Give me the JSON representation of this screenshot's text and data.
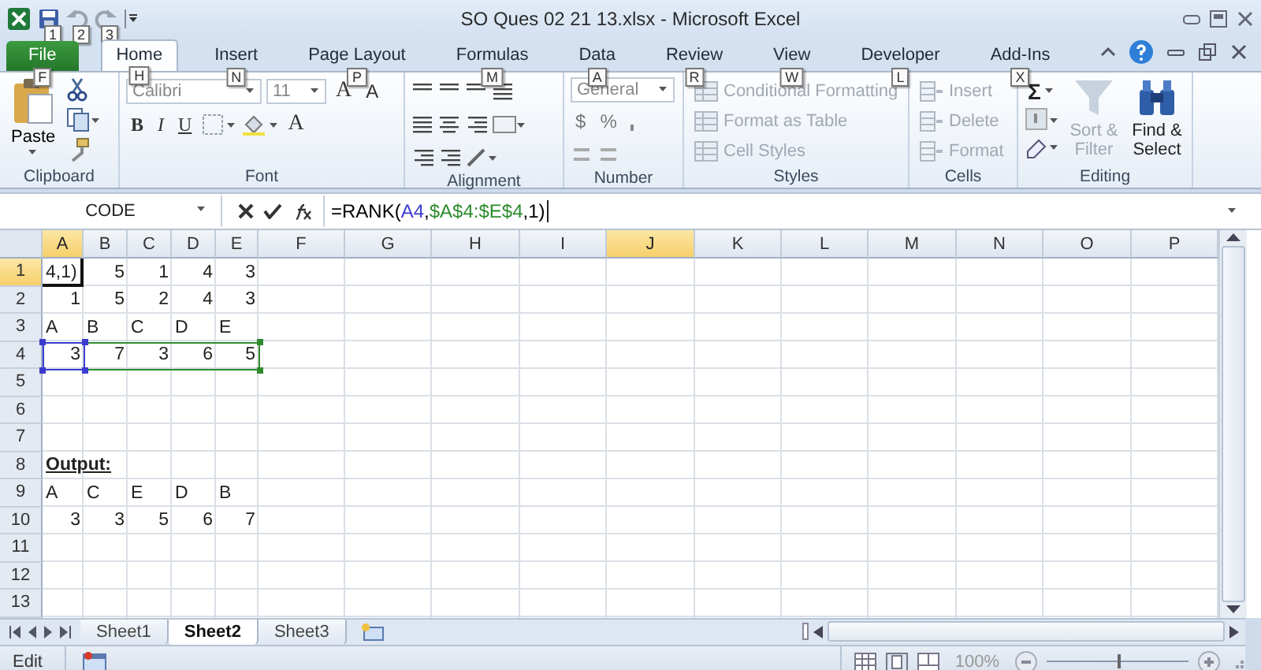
{
  "title_bar": {
    "quick_access": [
      {
        "kind": "save",
        "keytip": "1"
      },
      {
        "kind": "undo",
        "keytip": "2"
      },
      {
        "kind": "redo",
        "keytip": "3"
      }
    ],
    "title": "SO Ques 02 21 13.xlsx - Microsoft Excel"
  },
  "tabs": [
    {
      "label": "File",
      "keytip": "F",
      "kind": "file",
      "selected": false
    },
    {
      "label": "Home",
      "keytip": "H",
      "kind": "tab",
      "selected": true
    },
    {
      "label": "Insert",
      "keytip": "N",
      "kind": "tab",
      "selected": false
    },
    {
      "label": "Page Layout",
      "keytip": "P",
      "kind": "tab",
      "selected": false
    },
    {
      "label": "Formulas",
      "keytip": "M",
      "kind": "tab",
      "selected": false
    },
    {
      "label": "Data",
      "keytip": "A",
      "kind": "tab",
      "selected": false
    },
    {
      "label": "Review",
      "keytip": "R",
      "kind": "tab",
      "selected": false
    },
    {
      "label": "View",
      "keytip": "W",
      "kind": "tab",
      "selected": false
    },
    {
      "label": "Developer",
      "keytip": "L",
      "kind": "tab",
      "selected": false
    },
    {
      "label": "Add-Ins",
      "keytip": "X",
      "kind": "tab",
      "selected": false
    }
  ],
  "ribbon": {
    "clipboard": {
      "label": "Clipboard",
      "paste": "Paste"
    },
    "font": {
      "label": "Font",
      "name": "Calibri",
      "size": "11",
      "grow": "A",
      "shrink": "A",
      "bold": "B",
      "italic": "I",
      "underline": "U",
      "font_color": "A"
    },
    "alignment": {
      "label": "Alignment"
    },
    "number": {
      "label": "Number",
      "format": "General",
      "symbols": [
        "$",
        "%"
      ]
    },
    "styles": {
      "label": "Styles",
      "items": [
        {
          "label": "Conditional Formatting",
          "disabled": true
        },
        {
          "label": "Format as Table",
          "disabled": true
        },
        {
          "label": "Cell Styles",
          "disabled": true
        }
      ]
    },
    "cells": {
      "label": "Cells",
      "items": [
        {
          "label": "Insert",
          "disabled": true
        },
        {
          "label": "Delete",
          "disabled": true
        },
        {
          "label": "Format",
          "disabled": true
        }
      ]
    },
    "editing": {
      "label": "Editing",
      "sum": "Σ",
      "sort": {
        "label": "Sort & Filter",
        "disabled": true
      },
      "find": {
        "label": "Find & Select",
        "disabled": false
      }
    }
  },
  "formula_bar": {
    "name_box": "CODE",
    "parts": [
      {
        "text": "=RANK(",
        "color": "#000000"
      },
      {
        "text": "A4",
        "color": "#3c3cd0"
      },
      {
        "text": ",",
        "color": "#000000"
      },
      {
        "text": "$A$4:$E$4",
        "color": "#2e8b2e"
      },
      {
        "text": ",1)",
        "color": "#000000"
      }
    ]
  },
  "columns": [
    {
      "label": "A",
      "selected": true
    },
    {
      "label": "B",
      "selected": false
    },
    {
      "label": "C",
      "selected": false
    },
    {
      "label": "D",
      "selected": false
    },
    {
      "label": "E",
      "selected": false
    },
    {
      "label": "F",
      "selected": false
    },
    {
      "label": "G",
      "selected": false
    },
    {
      "label": "H",
      "selected": false
    },
    {
      "label": "I",
      "selected": false
    },
    {
      "label": "J",
      "selected": true
    },
    {
      "label": "K",
      "selected": false
    },
    {
      "label": "L",
      "selected": false
    },
    {
      "label": "M",
      "selected": false
    },
    {
      "label": "N",
      "selected": false
    },
    {
      "label": "O",
      "selected": false
    },
    {
      "label": "P",
      "selected": false
    }
  ],
  "rows": [
    {
      "number": "1",
      "selected": true,
      "editing": true,
      "kind": "number",
      "cells": [
        "4,1)",
        "5",
        "1",
        "4",
        "3"
      ]
    },
    {
      "number": "2",
      "selected": false,
      "editing": false,
      "kind": "number",
      "cells": [
        "1",
        "5",
        "2",
        "4",
        "3"
      ]
    },
    {
      "number": "3",
      "selected": false,
      "editing": false,
      "kind": "text",
      "cells": [
        "A",
        "B",
        "C",
        "D",
        "E"
      ]
    },
    {
      "number": "4",
      "selected": false,
      "editing": false,
      "kind": "number",
      "cells": [
        "3",
        "7",
        "3",
        "6",
        "5"
      ]
    },
    {
      "number": "5",
      "selected": false,
      "editing": false,
      "kind": "text",
      "cells": []
    },
    {
      "number": "6",
      "selected": false,
      "editing": false,
      "kind": "text",
      "cells": []
    },
    {
      "number": "7",
      "selected": false,
      "editing": false,
      "kind": "text",
      "cells": []
    },
    {
      "number": "8",
      "selected": false,
      "editing": false,
      "kind": "heading",
      "cells": [
        "Output:"
      ]
    },
    {
      "number": "9",
      "selected": false,
      "editing": false,
      "kind": "text",
      "cells": [
        "A",
        "C",
        "E",
        "D",
        "B"
      ]
    },
    {
      "number": "10",
      "selected": false,
      "editing": false,
      "kind": "number",
      "cells": [
        "3",
        "3",
        "5",
        "6",
        "7"
      ]
    },
    {
      "number": "11",
      "selected": false,
      "editing": false,
      "kind": "text",
      "cells": []
    },
    {
      "number": "12",
      "selected": false,
      "editing": false,
      "kind": "text",
      "cells": []
    },
    {
      "number": "13",
      "selected": false,
      "editing": false,
      "kind": "text",
      "cells": []
    }
  ],
  "sheets": [
    {
      "label": "Sheet1",
      "selected": false
    },
    {
      "label": "Sheet2",
      "selected": true
    },
    {
      "label": "Sheet3",
      "selected": false
    }
  ],
  "status_bar": {
    "mode": "Edit",
    "zoom": "100%",
    "zoom_slider": {
      "level": 0.5
    }
  }
}
